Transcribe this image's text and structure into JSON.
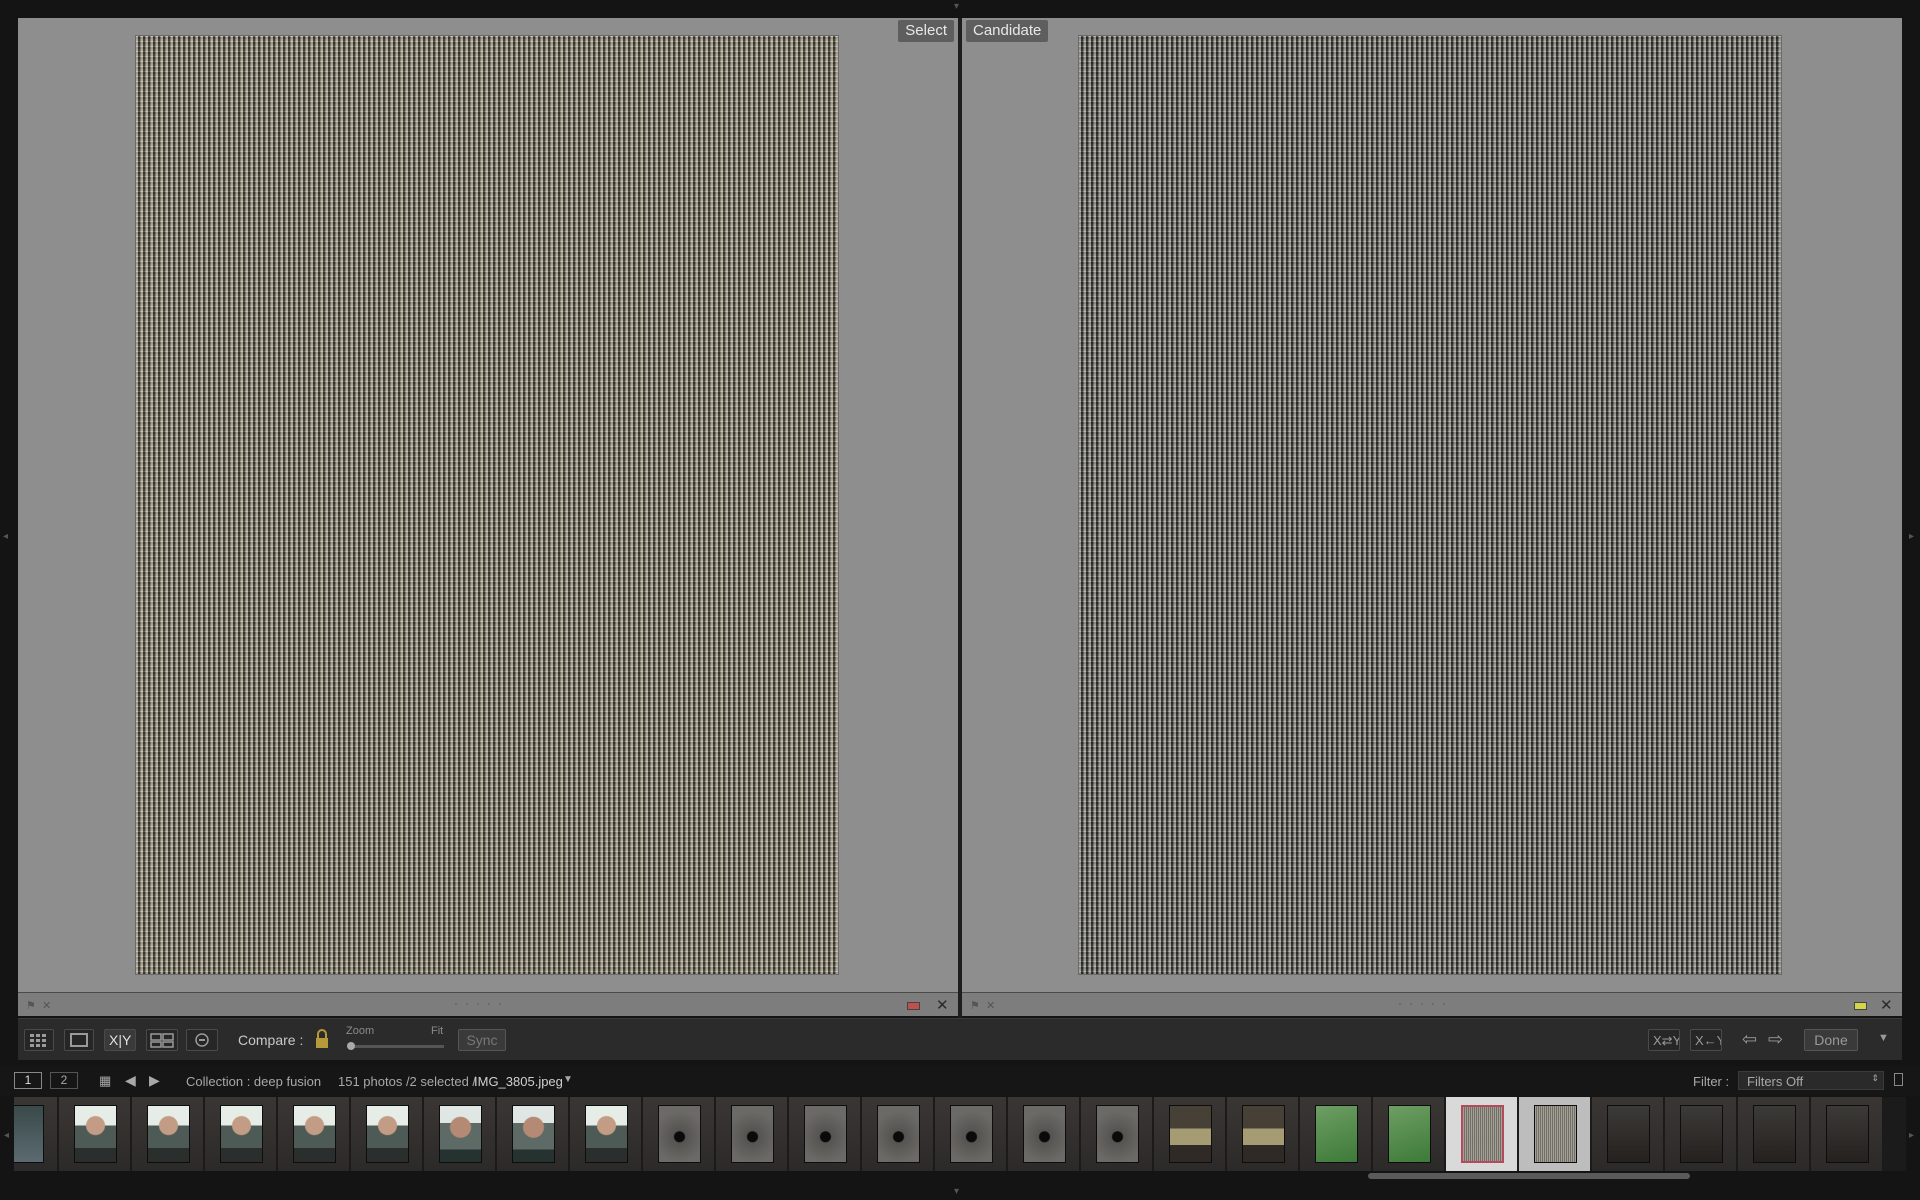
{
  "compare_view": {
    "left_label": "Select",
    "right_label": "Candidate",
    "left_color_label": "#c0504d",
    "right_color_label": "#d4d44a"
  },
  "toolbar": {
    "compare_label": "Compare :",
    "zoom_label": "Zoom",
    "fit_label": "Fit",
    "sync_label": "Sync",
    "done_label": "Done",
    "xy_label": "X|Y",
    "zoom_level": 0.0
  },
  "statusbar": {
    "screen1": "1",
    "screen2": "2",
    "collection": "Collection : deep fusion",
    "photos": "151 photos /2 selected /",
    "filename": "IMG_3805.jpeg",
    "filter_label": "Filter :",
    "filter_value": "Filters Off"
  },
  "filmstrip": {
    "thumbs": [
      {
        "kind": "tree-icon"
      },
      {
        "kind": "person-icon"
      },
      {
        "kind": "person-icon"
      },
      {
        "kind": "person-icon"
      },
      {
        "kind": "person-icon"
      },
      {
        "kind": "person-icon"
      },
      {
        "kind": "person2-icon"
      },
      {
        "kind": "person2-icon"
      },
      {
        "kind": "person-icon"
      },
      {
        "kind": "hole-icon"
      },
      {
        "kind": "hole-icon"
      },
      {
        "kind": "hole-icon"
      },
      {
        "kind": "hole-icon"
      },
      {
        "kind": "hole-icon"
      },
      {
        "kind": "hole-icon"
      },
      {
        "kind": "hole-icon"
      },
      {
        "kind": "glass-icon"
      },
      {
        "kind": "glass-icon"
      },
      {
        "kind": "green-icon"
      },
      {
        "kind": "green-icon"
      },
      {
        "kind": "fabric-select"
      },
      {
        "kind": "fabric-candidate"
      },
      {
        "kind": "tripod-icon"
      },
      {
        "kind": "tripod-icon"
      },
      {
        "kind": "tripod-icon"
      },
      {
        "kind": "tripod-icon"
      }
    ]
  }
}
